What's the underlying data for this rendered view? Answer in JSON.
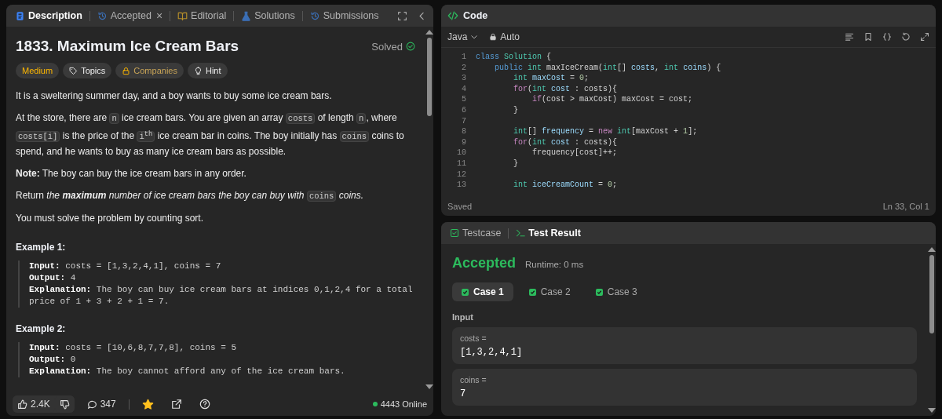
{
  "description_panel": {
    "tabs": [
      {
        "label": "Description",
        "selected": true
      },
      {
        "label": "Accepted",
        "selected": false,
        "close": "×"
      },
      {
        "label": "Editorial",
        "selected": false
      },
      {
        "label": "Solutions",
        "selected": false
      },
      {
        "label": "Submissions",
        "selected": false
      }
    ],
    "title": "1833. Maximum Ice Cream Bars",
    "status": "Solved",
    "tags": [
      {
        "label": "Medium",
        "kind": "difficulty"
      },
      {
        "label": "Topics",
        "kind": "topics"
      },
      {
        "label": "Companies",
        "kind": "companies"
      },
      {
        "label": "Hint",
        "kind": "hint"
      }
    ],
    "paragraphs": [
      [
        {
          "text": "It is a sweltering summer day, and a boy wants to buy some ice cream bars."
        }
      ],
      [
        {
          "text": "At the store, there are "
        },
        {
          "text": "n",
          "code": true
        },
        {
          "text": " ice cream bars. You are given an array "
        },
        {
          "text": "costs",
          "code": true
        },
        {
          "text": " of length "
        },
        {
          "text": "n",
          "code": true
        },
        {
          "text": ", where "
        },
        {
          "text": "costs[i]",
          "code": true
        },
        {
          "text": " is the price of the "
        },
        {
          "text": "i$^{th}$",
          "code": true
        },
        {
          "text": " ice cream bar in coins. The boy initially has "
        },
        {
          "text": "coins",
          "code": true
        },
        {
          "text": " coins to spend, and he wants to buy as many ice cream bars as possible."
        }
      ],
      [
        {
          "text": "**Note:** The boy can buy the ice cream bars in any order."
        }
      ],
      [
        {
          "text": "Return "
        },
        {
          "text": "the **maximum** number of ice cream bars the boy can buy with ",
          "italic": true
        },
        {
          "text": "coins",
          "code": true
        },
        {
          "text": " coins.",
          "italic": true
        }
      ],
      [
        {
          "text": "You must solve the problem by counting sort."
        }
      ]
    ],
    "examples": [
      {
        "title": "Example 1:",
        "lines": [
          {
            "label": "Input:",
            "text": "costs = [1,3,2,4,1], coins = 7"
          },
          {
            "label": "Output:",
            "text": "4"
          },
          {
            "label": "Explanation:",
            "text": "The boy can buy ice cream bars at indices 0,1,2,4 for a total price of 1 + 3 + 2 + 1 = 7."
          }
        ]
      },
      {
        "title": "Example 2:",
        "lines": [
          {
            "label": "Input:",
            "text": "costs = [10,6,8,7,7,8], coins = 5"
          },
          {
            "label": "Output:",
            "text": "0"
          },
          {
            "label": "Explanation:",
            "text": "The boy cannot afford any of the ice cream bars."
          }
        ]
      }
    ],
    "footer": {
      "likes": "2.4K",
      "comments": "347",
      "starred": true,
      "online": "4443 Online"
    }
  },
  "code_panel": {
    "title": "Code",
    "language": "Java",
    "mode": "Auto",
    "status": "Saved",
    "cursor": "Ln 33, Col 1",
    "lines": [
      {
        "number": "1",
        "tokens": [
          {
            "kind": "kw",
            "text": "class"
          },
          {
            "kind": "type",
            "text": " Solution"
          },
          {
            "kind": "plain",
            "text": " {"
          }
        ]
      },
      {
        "number": "2",
        "tokens": [
          {
            "kind": "kw",
            "text": "    public"
          },
          {
            "kind": "type",
            "text": " int"
          },
          {
            "kind": "plain",
            "text": " maxIceCream("
          },
          {
            "kind": "type",
            "text": "int"
          },
          {
            "kind": "plain",
            "text": "[] "
          },
          {
            "kind": "var",
            "text": "costs"
          },
          {
            "kind": "plain",
            "text": ", "
          },
          {
            "kind": "type",
            "text": "int"
          },
          {
            "kind": "var",
            "text": " coins"
          },
          {
            "kind": "plain",
            "text": ") {"
          }
        ]
      },
      {
        "number": "3",
        "tokens": [
          {
            "kind": "type",
            "text": "        int"
          },
          {
            "kind": "var",
            "text": " maxCost"
          },
          {
            "kind": "plain",
            "text": " = "
          },
          {
            "kind": "num",
            "text": "0"
          },
          {
            "kind": "plain",
            "text": ";"
          }
        ]
      },
      {
        "number": "4",
        "tokens": [
          {
            "kind": "ctrl",
            "text": "        for"
          },
          {
            "kind": "plain",
            "text": "("
          },
          {
            "kind": "type",
            "text": "int"
          },
          {
            "kind": "var",
            "text": " cost"
          },
          {
            "kind": "plain",
            "text": " : costs){"
          }
        ]
      },
      {
        "number": "5",
        "tokens": [
          {
            "kind": "ctrl",
            "text": "            if"
          },
          {
            "kind": "plain",
            "text": "(cost > maxCost) maxCost = cost;"
          }
        ]
      },
      {
        "number": "6",
        "tokens": [
          {
            "kind": "plain",
            "text": "        }"
          }
        ]
      },
      {
        "number": "7"
      },
      {
        "number": "8",
        "tokens": [
          {
            "kind": "type",
            "text": "        int"
          },
          {
            "kind": "plain",
            "text": "[] "
          },
          {
            "kind": "var",
            "text": "frequency"
          },
          {
            "kind": "plain",
            "text": " = "
          },
          {
            "kind": "ctrl",
            "text": "new"
          },
          {
            "kind": "type",
            "text": " int"
          },
          {
            "kind": "plain",
            "text": "[maxCost + "
          },
          {
            "kind": "num",
            "text": "1"
          },
          {
            "kind": "plain",
            "text": "];"
          }
        ]
      },
      {
        "number": "9",
        "tokens": [
          {
            "kind": "ctrl",
            "text": "        for"
          },
          {
            "kind": "plain",
            "text": "("
          },
          {
            "kind": "type",
            "text": "int"
          },
          {
            "kind": "var",
            "text": " cost"
          },
          {
            "kind": "plain",
            "text": " : costs){"
          }
        ]
      },
      {
        "number": "10",
        "tokens": [
          {
            "kind": "plain",
            "text": "            frequency[cost]++;"
          }
        ]
      },
      {
        "number": "11",
        "tokens": [
          {
            "kind": "plain",
            "text": "        }"
          }
        ]
      },
      {
        "number": "12"
      },
      {
        "number": "13",
        "tokens": [
          {
            "kind": "type",
            "text": "        int"
          },
          {
            "kind": "var",
            "text": " iceCreamCount"
          },
          {
            "kind": "plain",
            "text": " = "
          },
          {
            "kind": "num",
            "text": "0"
          },
          {
            "kind": "plain",
            "text": ";"
          }
        ]
      }
    ]
  },
  "result_panel": {
    "tabs": [
      {
        "label": "Testcase",
        "selected": false
      },
      {
        "label": "Test Result",
        "selected": true
      }
    ],
    "verdict": "Accepted",
    "runtime": "Runtime: 0 ms",
    "cases": [
      {
        "label": "Case 1",
        "selected": true,
        "passed": true
      },
      {
        "label": "Case 2",
        "selected": false,
        "passed": true
      },
      {
        "label": "Case 3",
        "selected": false,
        "passed": true
      }
    ],
    "input_label": "Input",
    "params": [
      {
        "name": "costs =",
        "value": "[1,3,2,4,1]"
      },
      {
        "name": "coins =",
        "value": "7"
      }
    ]
  }
}
